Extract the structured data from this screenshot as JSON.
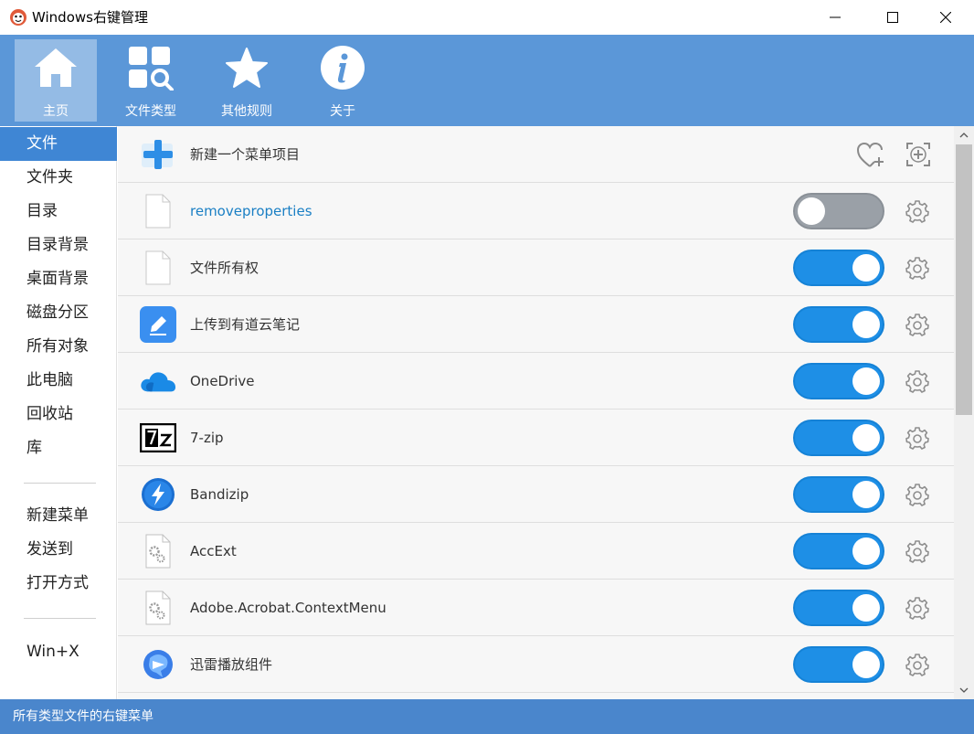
{
  "window": {
    "title": "Windows右键管理",
    "controls": {
      "minimize": "minimize-icon",
      "maximize": "maximize-icon",
      "close": "close-icon"
    }
  },
  "toolbar": {
    "items": [
      {
        "label": "主页",
        "icon": "home-icon",
        "active": true
      },
      {
        "label": "文件类型",
        "icon": "file-type-search-icon",
        "active": false
      },
      {
        "label": "其他规则",
        "icon": "star-icon",
        "active": false
      },
      {
        "label": "关于",
        "icon": "info-icon",
        "active": false
      }
    ]
  },
  "sidebar": {
    "items": [
      {
        "label": "文件",
        "active": true
      },
      {
        "label": "文件夹"
      },
      {
        "label": "目录"
      },
      {
        "label": "目录背景"
      },
      {
        "label": "桌面背景"
      },
      {
        "label": "磁盘分区"
      },
      {
        "label": "所有对象"
      },
      {
        "label": "此电脑"
      },
      {
        "label": "回收站"
      },
      {
        "label": "库"
      },
      {
        "label": "新建菜单"
      },
      {
        "label": "发送到"
      },
      {
        "label": "打开方式"
      },
      {
        "label": "Win+X"
      }
    ]
  },
  "list": {
    "new_item": {
      "label": "新建一个菜单项目",
      "icon": "plus-icon"
    },
    "items": [
      {
        "label": "removeproperties",
        "enabled": false,
        "icon": "blank-file-icon",
        "highlight": true
      },
      {
        "label": "文件所有权",
        "enabled": true,
        "icon": "blank-file-icon"
      },
      {
        "label": "上传到有道云笔记",
        "enabled": true,
        "icon": "youdao-note-icon"
      },
      {
        "label": "OneDrive",
        "enabled": true,
        "icon": "onedrive-cloud-icon"
      },
      {
        "label": "7-zip",
        "enabled": true,
        "icon": "7zip-icon"
      },
      {
        "label": "Bandizip",
        "enabled": true,
        "icon": "bandizip-icon"
      },
      {
        "label": "AccExt",
        "enabled": true,
        "icon": "gear-file-icon"
      },
      {
        "label": "Adobe.Acrobat.ContextMenu",
        "enabled": true,
        "icon": "gear-file-icon"
      },
      {
        "label": "迅雷播放组件",
        "enabled": true,
        "icon": "xunlei-player-icon"
      }
    ]
  },
  "statusbar": {
    "text": "所有类型文件的右键菜单"
  },
  "colors": {
    "toolbar_bg": "#5b97d8",
    "sidebar_active": "#3f86d4",
    "toggle_on": "#1e8fe6",
    "toggle_off": "#9aa0a7",
    "statusbar_bg": "#4a86cc",
    "link_text": "#1a7fc4"
  }
}
